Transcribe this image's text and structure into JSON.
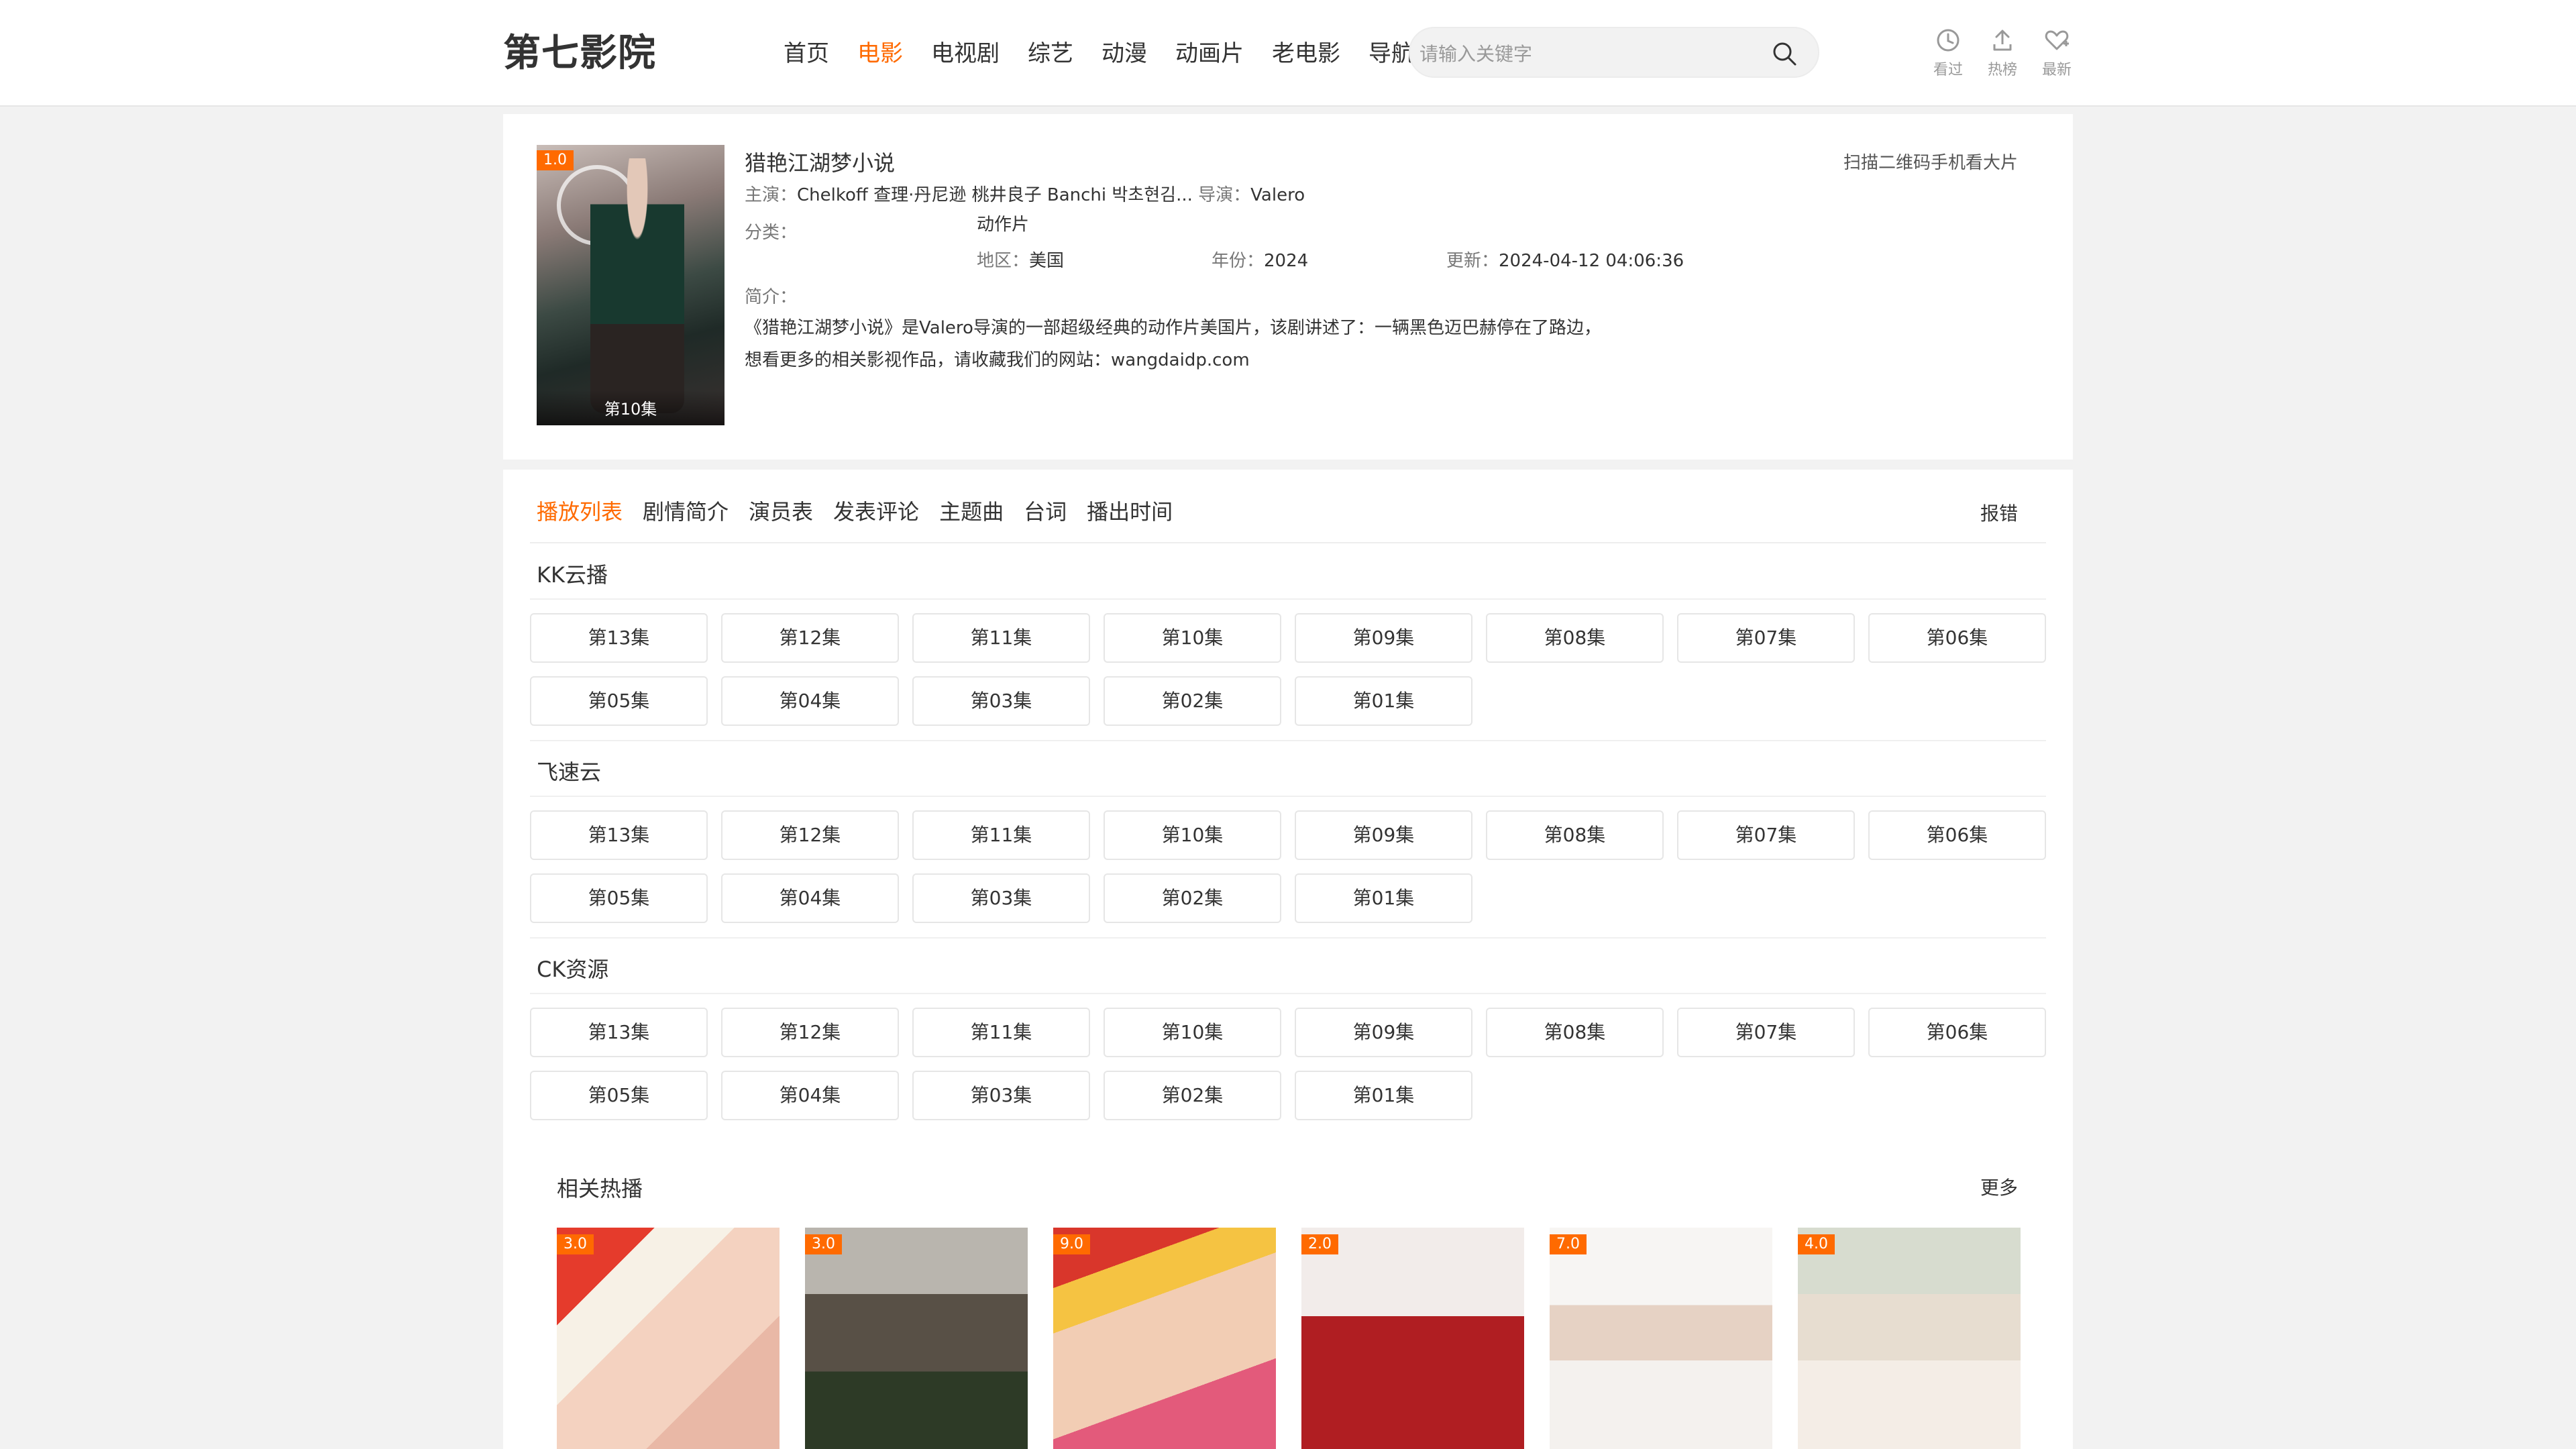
{
  "header": {
    "logo": "第七影院",
    "nav": [
      {
        "label": "首页",
        "active": false
      },
      {
        "label": "电影",
        "active": true
      },
      {
        "label": "电视剧",
        "active": false
      },
      {
        "label": "综艺",
        "active": false
      },
      {
        "label": "动漫",
        "active": false
      },
      {
        "label": "动画片",
        "active": false
      },
      {
        "label": "老电影",
        "active": false
      },
      {
        "label": "导航",
        "active": false,
        "dropdown": true
      }
    ],
    "search": {
      "placeholder": "请输入关键字"
    },
    "icons": [
      {
        "name": "history-icon",
        "label": "看过"
      },
      {
        "name": "upload-icon",
        "label": "热榜"
      },
      {
        "name": "heart-icon",
        "label": "最新"
      }
    ]
  },
  "detail": {
    "score": "1.0",
    "poster_episode": "第10集",
    "title": "猎艳江湖梦小说",
    "qr_text": "扫描二维码手机看大片",
    "actors_label": "主演：",
    "actors": "Chelkoff 查理·丹尼逊 桃井良子 Banchi 박초현김...",
    "director_label": "导演：",
    "director": "Valero",
    "category_label": "分类：",
    "category": "动作片",
    "region_label": "地区：",
    "region": "美国",
    "year_label": "年份：",
    "year": "2024",
    "updated_label": "更新：",
    "updated": "2024-04-12 04:06:36",
    "intro_label": "简介：",
    "intro_line1": "《猎艳江湖梦小说》是Valero导演的一部超级经典的动作片美国片，该剧讲述了：一辆黑色迈巴赫停在了路边，",
    "intro_line2": "想看更多的相关影视作品，请收藏我们的网站：wangdaidp.com"
  },
  "tabs": [
    "播放列表",
    "剧情简介",
    "演员表",
    "发表评论",
    "主题曲",
    "台词",
    "播出时间"
  ],
  "report_label": "报错",
  "sources": [
    {
      "name": "KK云播",
      "episodes": [
        "第13集",
        "第12集",
        "第11集",
        "第10集",
        "第09集",
        "第08集",
        "第07集",
        "第06集",
        "第05集",
        "第04集",
        "第03集",
        "第02集",
        "第01集"
      ]
    },
    {
      "name": "飞速云",
      "episodes": [
        "第13集",
        "第12集",
        "第11集",
        "第10集",
        "第09集",
        "第08集",
        "第07集",
        "第06集",
        "第05集",
        "第04集",
        "第03集",
        "第02集",
        "第01集"
      ]
    },
    {
      "name": "CK资源",
      "episodes": [
        "第13集",
        "第12集",
        "第11集",
        "第10集",
        "第09集",
        "第08集",
        "第07集",
        "第06集",
        "第05集",
        "第04集",
        "第03集",
        "第02集",
        "第01集"
      ]
    }
  ],
  "related": {
    "title": "相关热播",
    "more": "更多",
    "items": [
      {
        "score": "3.0"
      },
      {
        "score": "3.0"
      },
      {
        "score": "9.0"
      },
      {
        "score": "2.0"
      },
      {
        "score": "7.0"
      },
      {
        "score": "4.0"
      }
    ]
  },
  "colors": {
    "accent": "#ff6a00",
    "background": "#f2f2f2"
  }
}
